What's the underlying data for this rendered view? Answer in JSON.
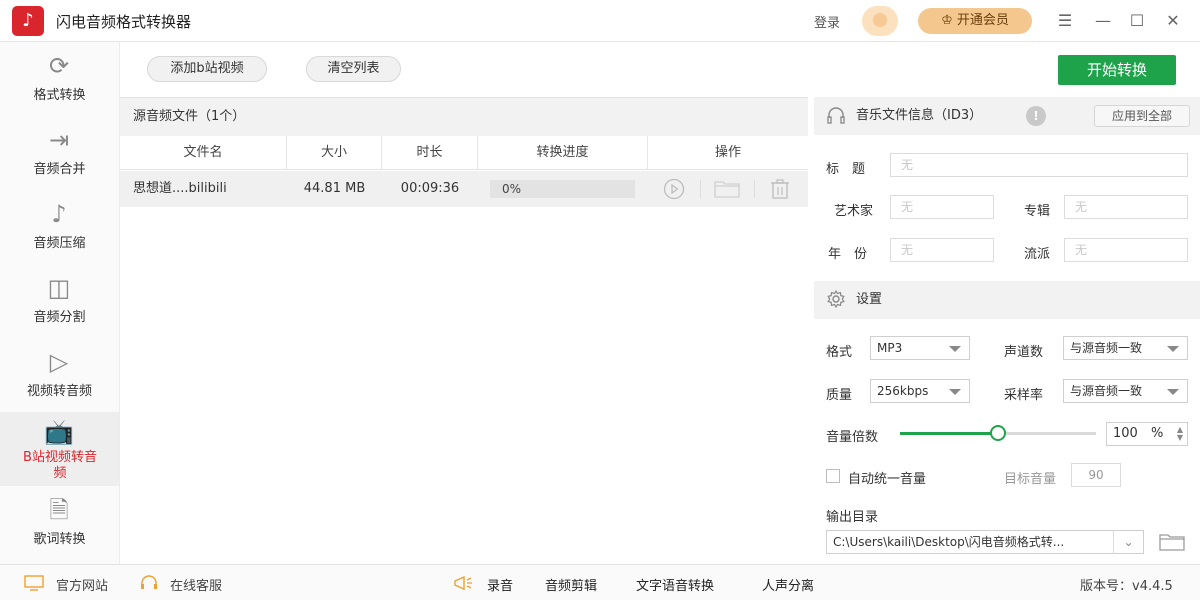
{
  "app": {
    "title": "闪电音频格式转换器",
    "logo_glyph": "♪",
    "login_label": "登录",
    "vip_label": "开通会员",
    "vip_icon": "crown-icon"
  },
  "window_controls": {
    "menu": "☰",
    "minimize": "—",
    "maximize": "☐",
    "close": "✕"
  },
  "sidebar": {
    "items": [
      {
        "label": "格式转换",
        "icon": "refresh-icon",
        "glyph": "⟳"
      },
      {
        "label": "音频合并",
        "icon": "merge-icon",
        "glyph": "⇥"
      },
      {
        "label": "音频压缩",
        "icon": "music-disc-icon",
        "glyph": "♪"
      },
      {
        "label": "音频分割",
        "icon": "split-icon",
        "glyph": "◫"
      },
      {
        "label": "视频转音频",
        "icon": "video-icon",
        "glyph": "▷"
      },
      {
        "label": "B站视频转音频",
        "icon": "bilibili-icon",
        "glyph": "📺"
      },
      {
        "label": "歌词转换",
        "icon": "lyrics-icon",
        "glyph": "🗎"
      }
    ],
    "active_index": 5
  },
  "toolbar": {
    "add_label": "添加b站视频",
    "clear_label": "清空列表",
    "start_label": "开始转换"
  },
  "file_panel": {
    "title": "源音频文件（1个）",
    "columns": [
      "文件名",
      "大小",
      "时长",
      "转换进度",
      "操作"
    ],
    "rows": [
      {
        "name": "思想道....bilibili",
        "size": "44.81 MB",
        "duration": "00:09:36",
        "progress_text": "0%",
        "progress": 0
      }
    ]
  },
  "id3": {
    "title": "音乐文件信息（ID3）",
    "apply_all": "应用到全部",
    "fields": {
      "title_label": "标　题",
      "title_value": "无",
      "artist_label": "艺术家",
      "artist_value": "无",
      "album_label": "专辑",
      "album_value": "无",
      "year_label": "年　份",
      "year_value": "无",
      "genre_label": "流派",
      "genre_value": "无"
    }
  },
  "settings": {
    "title": "设置",
    "format_label": "格式",
    "format_value": "MP3",
    "channels_label": "声道数",
    "channels_value": "与源音频一致",
    "quality_label": "质量",
    "quality_value": "256kbps",
    "samplerate_label": "采样率",
    "samplerate_value": "与源音频一致",
    "volume_label": "音量倍数",
    "volume_value": "100",
    "volume_unit": "%",
    "volume_fraction": 0.5,
    "auto_volume_label": "自动统一音量",
    "auto_volume_checked": false,
    "target_volume_label": "目标音量",
    "target_volume_value": "90",
    "output_label": "输出目录",
    "output_path": "C:\\Users\\kaili\\Desktop\\闪电音频格式转..."
  },
  "statusbar": {
    "website": "官方网站",
    "support": "在线客服",
    "links": [
      "录音",
      "音频剪辑",
      "文字语音转换",
      "人声分离"
    ],
    "version": "版本号：v4.4.5"
  }
}
